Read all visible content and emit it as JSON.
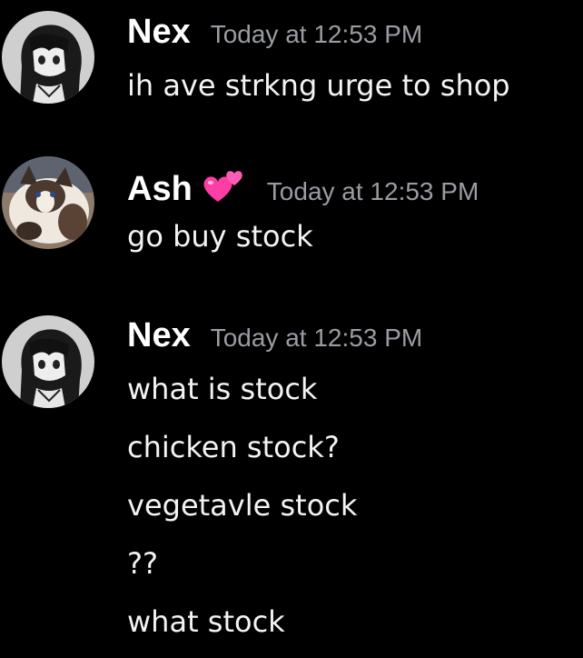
{
  "messages": [
    {
      "username": "Nex",
      "timestamp": "Today at 12:53 PM",
      "avatar": "anime-girl-avatar",
      "lines": [
        "ih ave strkng urge to shop"
      ]
    },
    {
      "username": "Ash",
      "badge": "two-hearts-emoji",
      "timestamp": "Today at 12:53 PM",
      "avatar": "ragdoll-cat-avatar",
      "lines": [
        "go buy stock"
      ]
    },
    {
      "username": "Nex",
      "timestamp": "Today at 12:53 PM",
      "avatar": "anime-girl-avatar",
      "lines": [
        "what is stock",
        "chicken stock?",
        "vegetavle stock",
        "??",
        "what stock"
      ]
    }
  ],
  "colors": {
    "background": "#000000",
    "username": "#ffffff",
    "timestamp": "#9a9ca3",
    "message_text": "#f2f3f5",
    "heart": "#ff3ea5"
  }
}
